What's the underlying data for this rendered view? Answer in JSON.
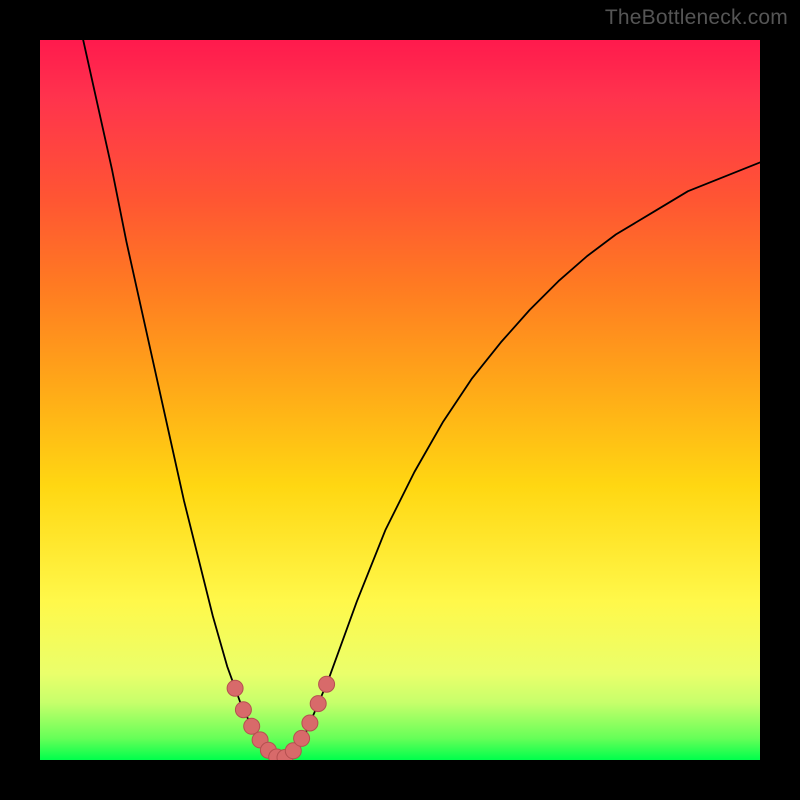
{
  "watermark": "TheBottleneck.com",
  "chart_data": {
    "type": "line",
    "title": "",
    "xlabel": "",
    "ylabel": "",
    "xlim": [
      0,
      1
    ],
    "ylim": [
      0,
      1
    ],
    "series": [
      {
        "name": "curve",
        "x": [
          0.06,
          0.08,
          0.1,
          0.12,
          0.14,
          0.16,
          0.18,
          0.2,
          0.22,
          0.24,
          0.26,
          0.28,
          0.3,
          0.32,
          0.335,
          0.35,
          0.37,
          0.4,
          0.44,
          0.48,
          0.52,
          0.56,
          0.6,
          0.64,
          0.68,
          0.72,
          0.76,
          0.8,
          0.85,
          0.9,
          0.95,
          1.0
        ],
        "y": [
          1.0,
          0.91,
          0.82,
          0.72,
          0.63,
          0.54,
          0.45,
          0.36,
          0.28,
          0.2,
          0.13,
          0.075,
          0.035,
          0.01,
          0.0,
          0.01,
          0.04,
          0.11,
          0.22,
          0.32,
          0.4,
          0.47,
          0.53,
          0.58,
          0.625,
          0.665,
          0.7,
          0.73,
          0.76,
          0.79,
          0.81,
          0.83
        ]
      }
    ],
    "highlighted_range_x": [
      0.271,
      0.398
    ],
    "highlighted_range_desc": "sweet-spot region around curve minimum",
    "background_gradient": {
      "stops": [
        "#ff1a4d",
        "#ff5533",
        "#ffa818",
        "#fff84a",
        "#66ff58",
        "#00ff4c"
      ],
      "axis": "y"
    }
  }
}
